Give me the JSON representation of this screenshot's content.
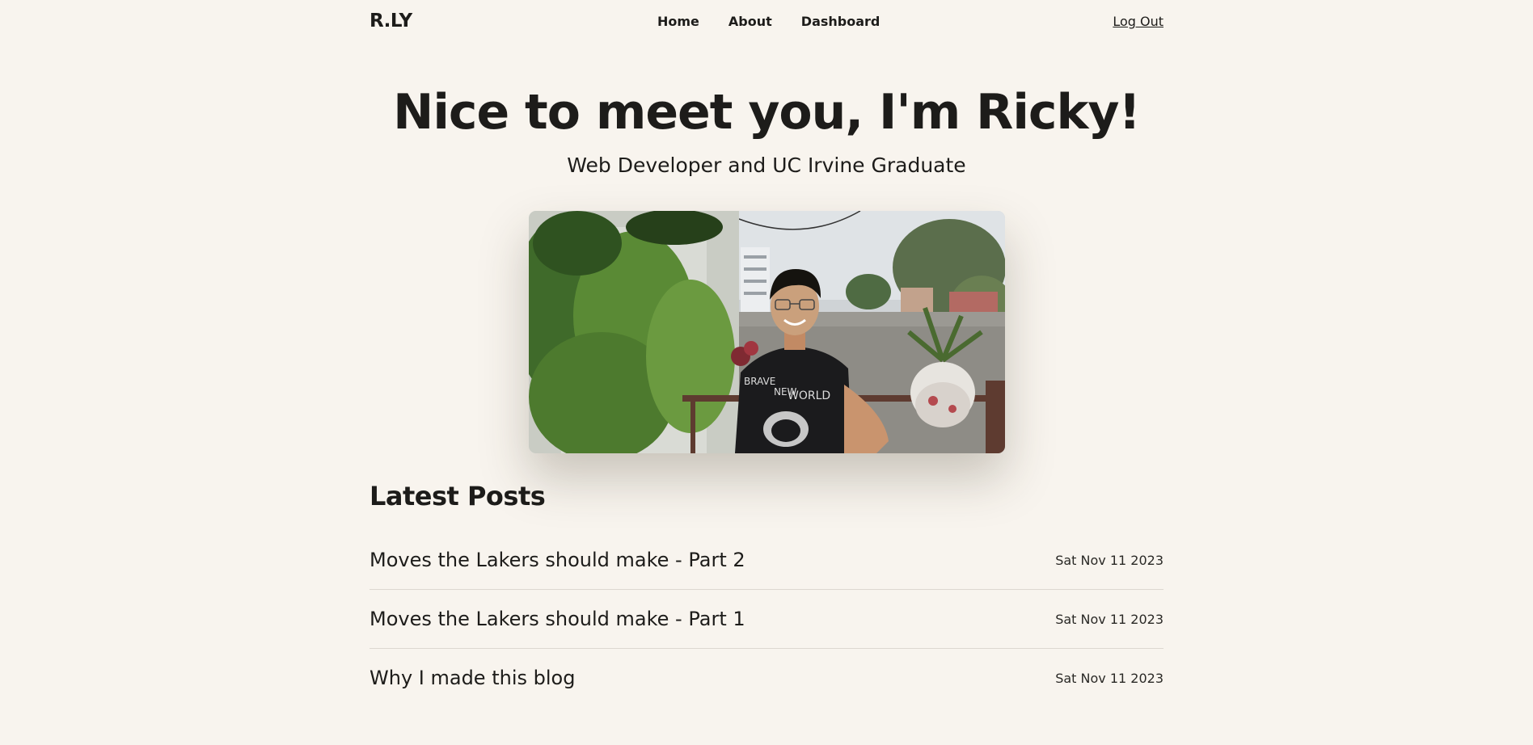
{
  "header": {
    "brand": "R.LY",
    "nav": [
      {
        "label": "Home"
      },
      {
        "label": "About"
      },
      {
        "label": "Dashboard"
      }
    ],
    "logout_label": "Log Out"
  },
  "hero": {
    "title": "Nice to meet you, I'm Ricky!",
    "subtitle": "Web Developer and UC Irvine Graduate"
  },
  "photo": {
    "shirt_text": [
      "BRAVE",
      "NEW",
      "WORLD"
    ]
  },
  "latest": {
    "title": "Latest Posts",
    "posts": [
      {
        "title": "Moves the Lakers should make - Part 2",
        "date": "Sat Nov 11 2023"
      },
      {
        "title": "Moves the Lakers should make - Part 1",
        "date": "Sat Nov 11 2023"
      },
      {
        "title": "Why I made this blog",
        "date": "Sat Nov 11 2023"
      }
    ]
  },
  "colors": {
    "background": "#f8f4ee",
    "text": "#1d1c1a",
    "divider": "#ddd8d0"
  }
}
